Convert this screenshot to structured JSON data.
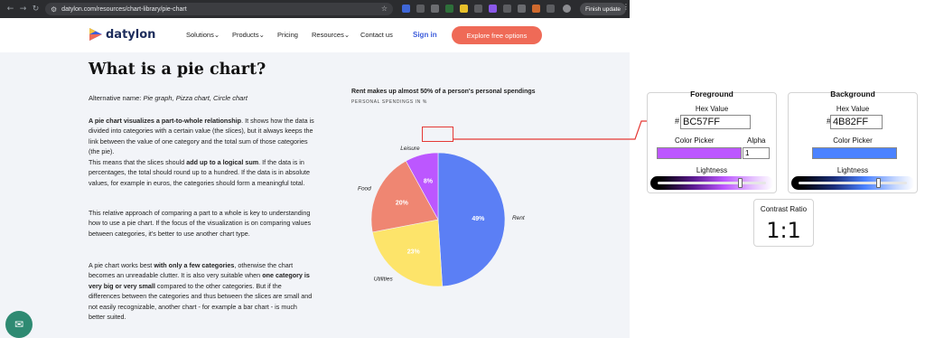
{
  "browser": {
    "url": "datylon.com/resources/chart-library/pie-chart",
    "finish_update_label": "Finish update"
  },
  "site": {
    "logo_text": "datylon",
    "nav": [
      {
        "label": "Solutions"
      },
      {
        "label": "Products"
      },
      {
        "label": "Pricing"
      },
      {
        "label": "Resources"
      },
      {
        "label": "Contact us"
      }
    ],
    "signin_label": "Sign in",
    "cta_label": "Explore free options",
    "heading": "What is a pie chart?",
    "alt_prefix": "Alternative name: ",
    "alt_names": "Pie graph, Pizza chart, Circle chart",
    "para1_bold": "A pie chart visualizes a part-to-whole relationship",
    "para1_rest": ". It shows how the data is divided into categories with a certain value (the slices), but it always keeps the link between the value of one category and the total sum of those categories (the pie).",
    "para2_start": "This means that the slices should ",
    "para2_bold": "add up to a logical sum",
    "para2_rest": ". If the data is in percentages, the total should round up to a hundred. If the data is in absolute values, for example in euros, the categories should form a meaningful total.",
    "para3": "This relative approach of comparing a part to a whole is key to understanding how to use a pie chart. If the focus of the visualization is on comparing values between categories, it's better to use another chart type.",
    "para4_start": "A pie chart works best ",
    "para4_bold1": "with only a few categories",
    "para4_mid": ", otherwise the chart becomes an unreadable clutter. It is also very suitable when ",
    "para4_bold2": "one category is very big or very small",
    "para4_rest": " compared to the other categories. But if the differences between the categories and thus between the slices are small and not easily recognizable, another chart - for example a bar chart - is much better suited."
  },
  "chart_data": {
    "type": "pie",
    "title": "Rent makes up almost 50% of a person's personal spendings",
    "subtitle": "PERSONAL SPENDINGS IN %",
    "slices": [
      {
        "label": "Rent",
        "value": 49,
        "value_label": "49%",
        "color": "#5B7FF5"
      },
      {
        "label": "Utilities",
        "value": 23,
        "value_label": "23%",
        "color": "#FDE46A"
      },
      {
        "label": "Food",
        "value": 20,
        "value_label": "20%",
        "color": "#EF8672"
      },
      {
        "label": "Leisure",
        "value": 8,
        "value_label": "8%",
        "color": "#BC57FF"
      }
    ]
  },
  "contrast_tool": {
    "foreground": {
      "title": "Foreground",
      "hex_label": "Hex Value",
      "hex_value": "BC57FF",
      "picker_label": "Color Picker",
      "alpha_label": "Alpha",
      "alpha_value": "1",
      "lightness_label": "Lightness",
      "lightness_level": 0.74,
      "color": "#BC57FF"
    },
    "background": {
      "title": "Background",
      "hex_label": "Hex Value",
      "hex_value": "4B82FF",
      "picker_label": "Color Picker",
      "lightness_label": "Lightness",
      "lightness_level": 0.72,
      "color": "#4B82FF"
    },
    "ratio_title": "Contrast Ratio",
    "ratio_value": "1:1"
  }
}
